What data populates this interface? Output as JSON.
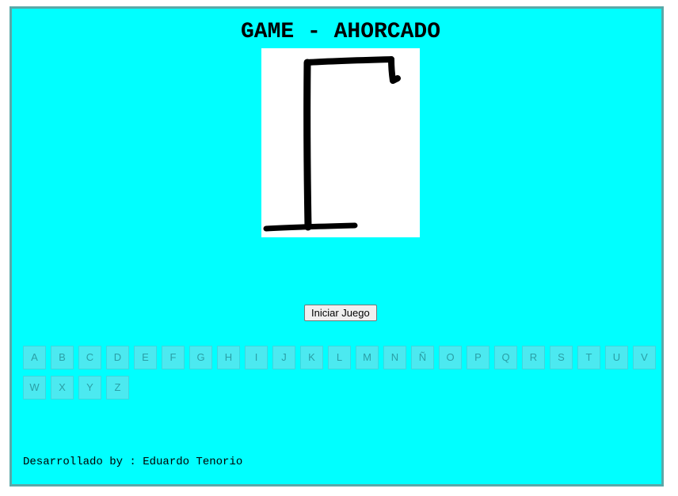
{
  "game": {
    "title": "GAME - AHORCADO",
    "start_button_label": "Iniciar Juego",
    "letters": [
      "A",
      "B",
      "C",
      "D",
      "E",
      "F",
      "G",
      "H",
      "I",
      "J",
      "K",
      "L",
      "M",
      "N",
      "Ñ",
      "O",
      "P",
      "Q",
      "R",
      "S",
      "T",
      "U",
      "V",
      "W",
      "X",
      "Y",
      "Z"
    ],
    "footer_text": "Desarrollado by : Eduardo Tenorio"
  },
  "colors": {
    "background": "#00ffff",
    "frame_border": "#5aa8a8",
    "letter_bg": "#4ce9f0",
    "letter_text": "#2a9fa6"
  }
}
